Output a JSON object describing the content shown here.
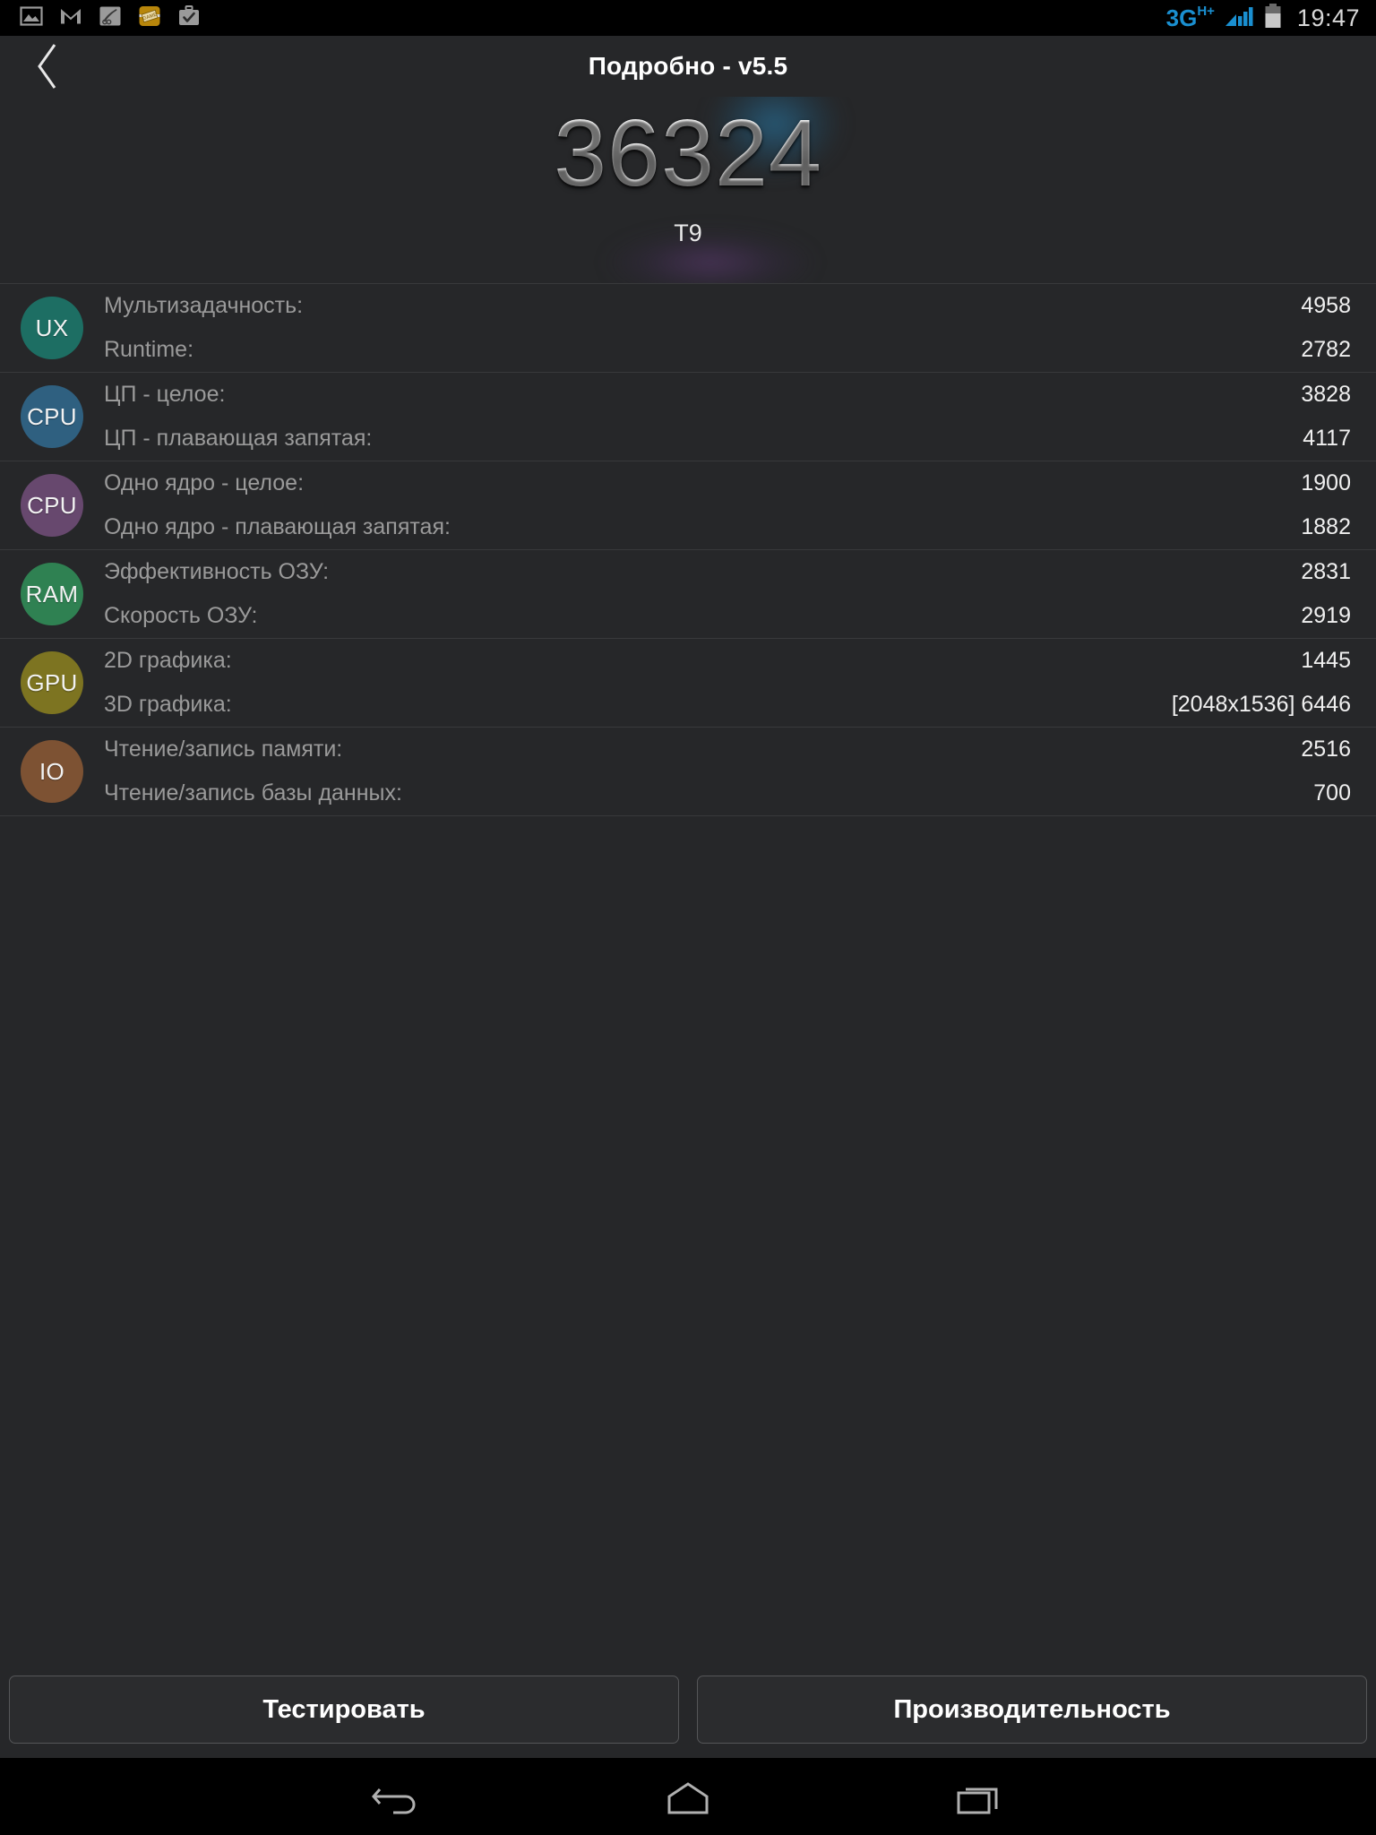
{
  "status_bar": {
    "left_icons": [
      {
        "name": "photo-icon",
        "label": "photo"
      },
      {
        "name": "gmail-icon",
        "label": "gmail"
      },
      {
        "name": "feather-icon",
        "label": "feather"
      },
      {
        "name": "game-ticket-icon",
        "label": "GAME"
      },
      {
        "name": "briefcase-check-icon",
        "label": "work"
      }
    ],
    "network_type": "3G",
    "network_suffix": "H+",
    "signal_bars": 4,
    "battery_level": "60%",
    "time": "19:47",
    "accent_color": "#1a8fd0"
  },
  "title_bar": {
    "back_label": "Назад",
    "title": "Подробно - v5.5"
  },
  "score": {
    "value": "36324",
    "subtitle": "T9"
  },
  "groups": [
    {
      "badge": "UX",
      "badge_color": "#1d6e63",
      "rows": [
        {
          "label": "Мультизадачность:",
          "value": "4958"
        },
        {
          "label": "Runtime:",
          "value": "2782"
        }
      ]
    },
    {
      "badge": "CPU",
      "badge_color": "#2f6080",
      "rows": [
        {
          "label": "ЦП - целое:",
          "value": "3828"
        },
        {
          "label": "ЦП - плавающая запятая:",
          "value": "4117"
        }
      ]
    },
    {
      "badge": "CPU",
      "badge_color": "#67486e",
      "rows": [
        {
          "label": "Одно ядро - целое:",
          "value": "1900"
        },
        {
          "label": "Одно ядро - плавающая запятая:",
          "value": "1882"
        }
      ]
    },
    {
      "badge": "RAM",
      "badge_color": "#2f8152",
      "rows": [
        {
          "label": "Эффективность ОЗУ:",
          "value": "2831"
        },
        {
          "label": "Скорость ОЗУ:",
          "value": "2919"
        }
      ]
    },
    {
      "badge": "GPU",
      "badge_color": "#7d7421",
      "rows": [
        {
          "label": "2D графика:",
          "value": "1445"
        },
        {
          "label": "3D графика:",
          "value": "[2048x1536] 6446"
        }
      ]
    },
    {
      "badge": "IO",
      "badge_color": "#7d5233",
      "rows": [
        {
          "label": "Чтение/запись памяти:",
          "value": "2516"
        },
        {
          "label": "Чтение/запись базы данных:",
          "value": "700"
        }
      ]
    }
  ],
  "buttons": {
    "test": "Тестировать",
    "performance": "Производительность"
  },
  "nav_bar": {
    "back": "back",
    "home": "home",
    "recents": "recents"
  }
}
